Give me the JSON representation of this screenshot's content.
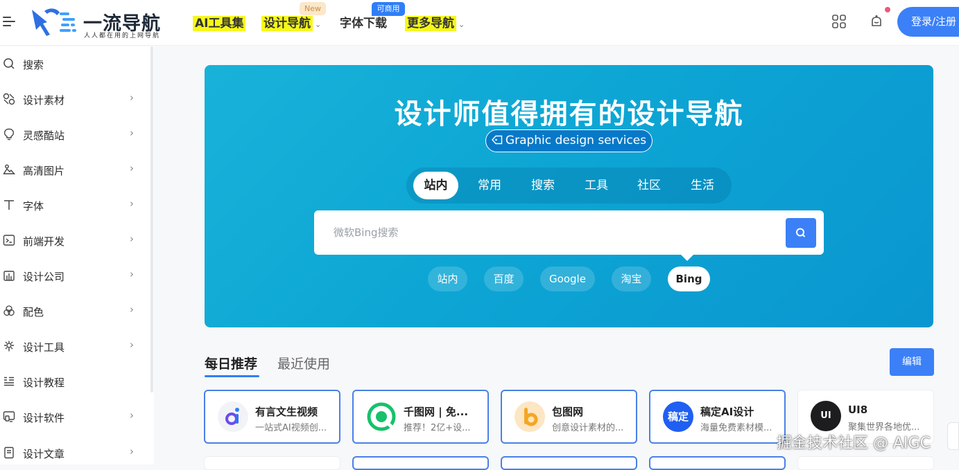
{
  "header": {
    "logo_title": "一流导航",
    "logo_sub": "人人都在用的上网导航",
    "nav": [
      {
        "label": "AI工具集",
        "highlight": true
      },
      {
        "label": "设计导航",
        "highlight": true,
        "caret": "⌄",
        "badge": "New"
      },
      {
        "label": "字体下载",
        "highlight": false,
        "badge": "可商用"
      },
      {
        "label": "更多导航",
        "highlight": true,
        "caret": "⌄"
      }
    ],
    "login_label": "登录/注册",
    "accent": "#3b80f7"
  },
  "sidebar": {
    "items": [
      {
        "label": "搜索",
        "icon": "search-icon",
        "arrow": ""
      },
      {
        "label": "设计素材",
        "icon": "material-icon",
        "arrow": "›"
      },
      {
        "label": "灵感酷站",
        "icon": "bulb-icon",
        "arrow": "›"
      },
      {
        "label": "高清图片",
        "icon": "image-icon",
        "arrow": "›"
      },
      {
        "label": "字体",
        "icon": "font-icon",
        "arrow": "›"
      },
      {
        "label": "前端开发",
        "icon": "terminal-icon",
        "arrow": "›"
      },
      {
        "label": "设计公司",
        "icon": "building-icon",
        "arrow": "›"
      },
      {
        "label": "配色",
        "icon": "palette-icon",
        "arrow": "›"
      },
      {
        "label": "设计工具",
        "icon": "tool-icon",
        "arrow": "›"
      },
      {
        "label": "设计教程",
        "icon": "list-icon",
        "arrow": ""
      },
      {
        "label": "设计软件",
        "icon": "software-icon",
        "arrow": "›"
      },
      {
        "label": "设计文章",
        "icon": "article-icon",
        "arrow": "›"
      }
    ]
  },
  "hero": {
    "title": "设计师值得拥有的设计导航",
    "subtitle": "Graphic design services",
    "tabs": [
      "站内",
      "常用",
      "搜索",
      "工具",
      "社区",
      "生活"
    ],
    "active_tab": "站内",
    "search_placeholder": "微软Bing搜索",
    "engines": [
      "站内",
      "百度",
      "Google",
      "淘宝",
      "Bing"
    ],
    "active_engine": "Bing"
  },
  "recommend": {
    "tab_active": "每日推荐",
    "tab_inactive": "最近使用",
    "edit_label": "编辑",
    "cards": [
      {
        "name": "有言文生视频",
        "desc": "一站式AI视频创..."
      },
      {
        "name": "千图网 | 免...",
        "desc": "推荐！2亿+设..."
      },
      {
        "name": "包图网",
        "desc": "创意设计素材的..."
      },
      {
        "name": "稿定AI设计",
        "desc": "海量免费素材模..."
      },
      {
        "name": "UI8",
        "desc": "聚集世界各地优..."
      }
    ],
    "logo_text": {
      "gaoding": "稿定",
      "ui8": "UI"
    }
  },
  "watermark": "掘金技术社区 @ AIGC"
}
